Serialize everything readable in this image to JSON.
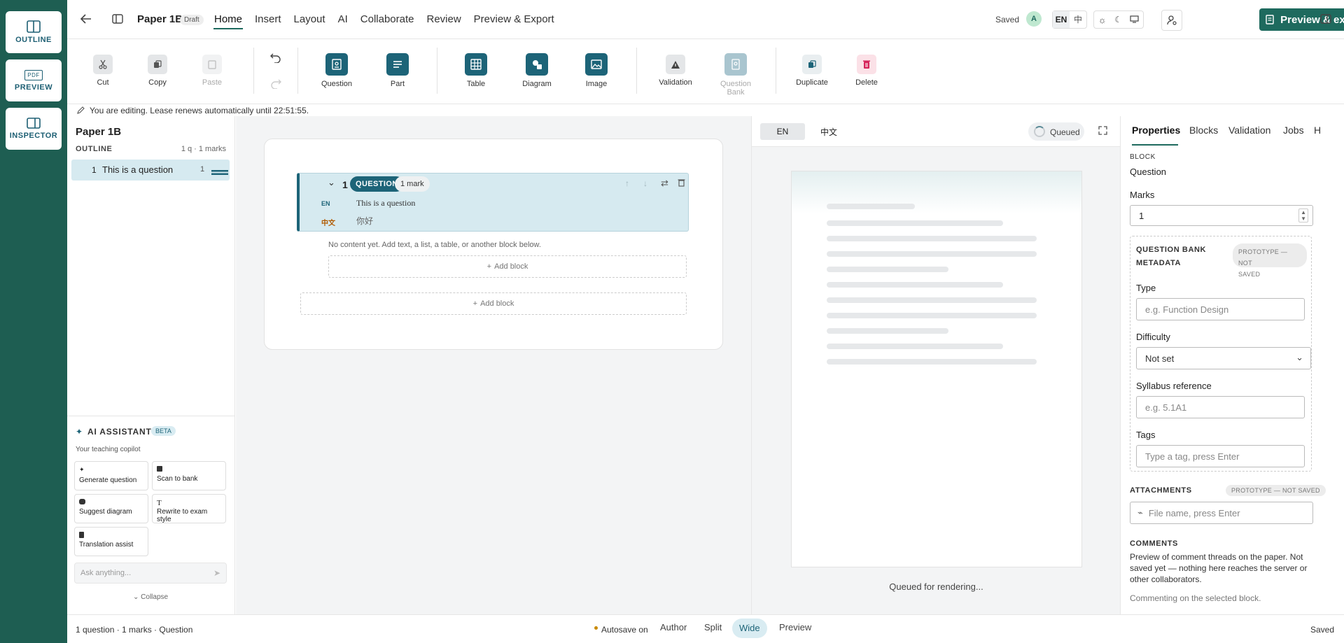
{
  "rail": {
    "outline": "OUTLINE",
    "preview": "PREVIEW",
    "preview_badge": "PDF",
    "inspector": "INSPECTOR"
  },
  "topbar": {
    "title": "Paper 1B",
    "status_badge": "Draft",
    "menu": [
      "Home",
      "Insert",
      "Layout",
      "AI",
      "Collaborate",
      "Review",
      "Preview & Export"
    ],
    "saved": "Saved",
    "avatar": "A",
    "lang_en": "EN",
    "lang_zh": "中",
    "export": "Preview & export"
  },
  "toolbar": {
    "cut": "Cut",
    "copy": "Copy",
    "paste": "Paste",
    "question": "Question",
    "part": "Part",
    "table": "Table",
    "diagram": "Diagram",
    "image": "Image",
    "validation": "Validation",
    "question_bank": "Question Bank",
    "duplicate": "Duplicate",
    "delete": "Delete"
  },
  "lease": "You are editing. Lease renews automatically until 22:51:55.",
  "outline": {
    "title": "Paper 1B",
    "heading": "OUTLINE",
    "summary": "1 q · 1 marks",
    "items": [
      {
        "num": "1",
        "label": "This is a question",
        "marks": "1"
      }
    ]
  },
  "ai": {
    "title": "AI ASSISTANT",
    "badge": "BETA",
    "subtitle": "Your teaching copilot",
    "actions": [
      "Generate question",
      "Scan to bank",
      "Suggest diagram",
      "Rewrite to exam style",
      "Translation assist"
    ],
    "ask_placeholder": "Ask anything...",
    "collapse": "Collapse"
  },
  "editor": {
    "qnum": "1",
    "qtype": "QUESTION",
    "marks": "1 mark",
    "en_label": "EN",
    "zh_label": "中文",
    "en_text": "This is a question",
    "zh_text": "你好",
    "empty_hint": "No content yet. Add text, a list, a table, or another block below.",
    "add_block": "Add block"
  },
  "preview": {
    "tab_en": "EN",
    "tab_zh": "中文",
    "status": "Queued",
    "footer": "Queued for rendering..."
  },
  "inspector": {
    "tabs": [
      "Properties",
      "Blocks",
      "Validation",
      "Jobs",
      "H"
    ],
    "block_label": "BLOCK",
    "block_value": "Question",
    "marks_label": "Marks",
    "marks_value": "1",
    "qb_title_1": "QUESTION BANK",
    "qb_title_2": "METADATA",
    "proto_1": "PROTOTYPE — NOT",
    "proto_2": "SAVED",
    "type_label": "Type",
    "type_placeholder": "e.g. Function Design",
    "difficulty_label": "Difficulty",
    "difficulty_value": "Not set",
    "syllabus_label": "Syllabus reference",
    "syllabus_placeholder": "e.g. 5.1A1",
    "tags_label": "Tags",
    "tags_placeholder": "Type a tag, press Enter",
    "attachments_label": "ATTACHMENTS",
    "attachments_proto": "PROTOTYPE — NOT SAVED",
    "attach_placeholder": "File name, press Enter",
    "comments_label": "COMMENTS",
    "comments_desc": "Preview of comment threads on the paper. Not saved yet — nothing here reaches the server or other collaborators.",
    "comments_hint": "Commenting on the selected block."
  },
  "statusbar": {
    "summary": "1 question · 1 marks · Question",
    "autosave": "Autosave on",
    "modes": [
      "Author",
      "Split",
      "Wide",
      "Preview"
    ],
    "active_mode": "Wide",
    "saved": "Saved"
  },
  "colors": {
    "rail": "#1e5e52",
    "accent": "#1e6a5e",
    "question": "#1d6478"
  }
}
